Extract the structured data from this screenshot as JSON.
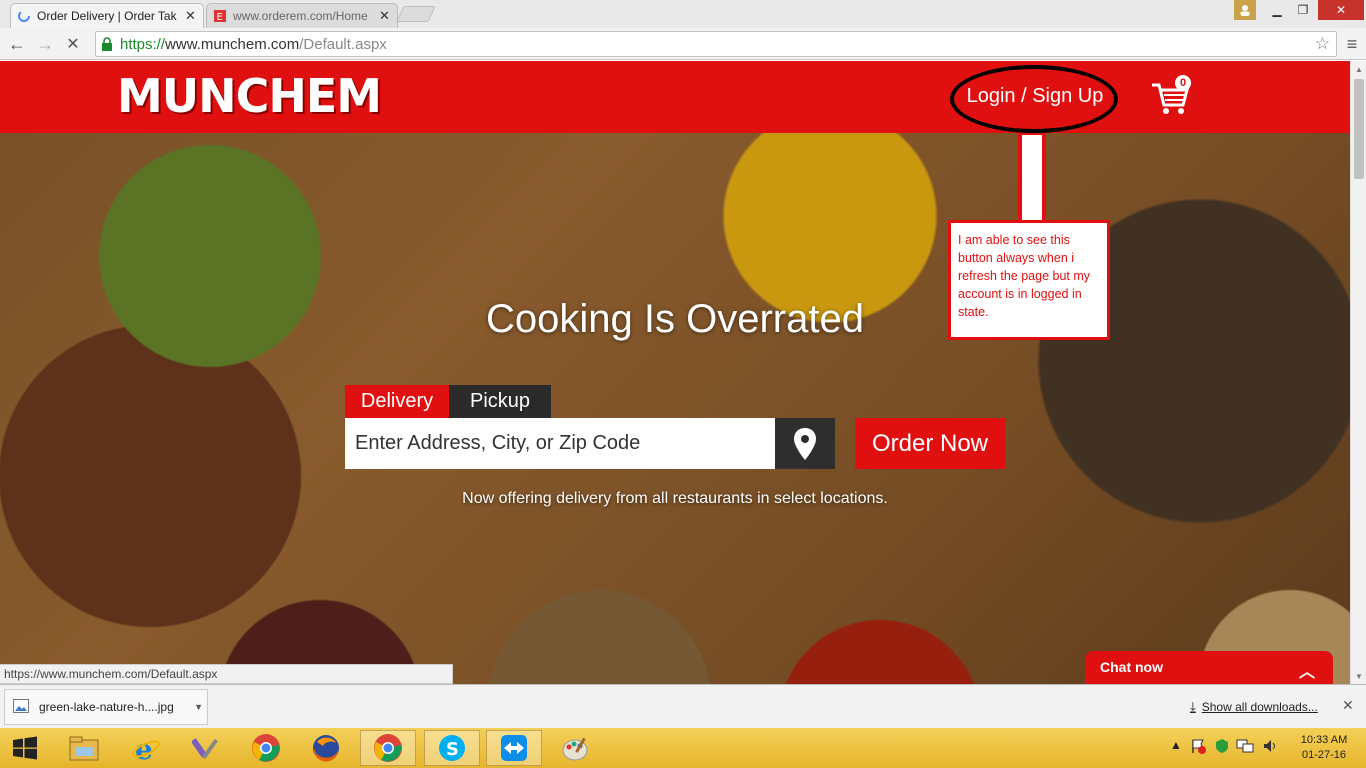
{
  "browser": {
    "tabs": [
      {
        "title": "Order Delivery | Order Tak",
        "active": true
      },
      {
        "title": "www.orderem.com/Home",
        "active": false
      }
    ],
    "url": {
      "scheme": "https://",
      "host": "www.munchem.com",
      "path": "/Default.aspx"
    },
    "status_url": "https://www.munchem.com/Default.aspx"
  },
  "site": {
    "logo": "MUNCHEM",
    "login_label": "Login / Sign Up",
    "cart_count": "0",
    "headline": "Cooking Is Overrated",
    "tabs": {
      "delivery": "Delivery",
      "pickup": "Pickup"
    },
    "address_placeholder": "Enter Address, City, or Zip Code",
    "order_button": "Order Now",
    "subline": "Now offering delivery from all restaurants in select locations.",
    "chat_label": "Chat now"
  },
  "annotation": {
    "text": "I am able to see this button always when i refresh the page but my account is in logged in state."
  },
  "downloads": {
    "item_name": "green-lake-nature-h....jpg",
    "show_all": "Show all downloads..."
  },
  "taskbar": {
    "time": "10:33 AM",
    "date": "01-27-16"
  },
  "colors": {
    "brand_red": "#e01010",
    "taskbar": "#f0c53a"
  }
}
